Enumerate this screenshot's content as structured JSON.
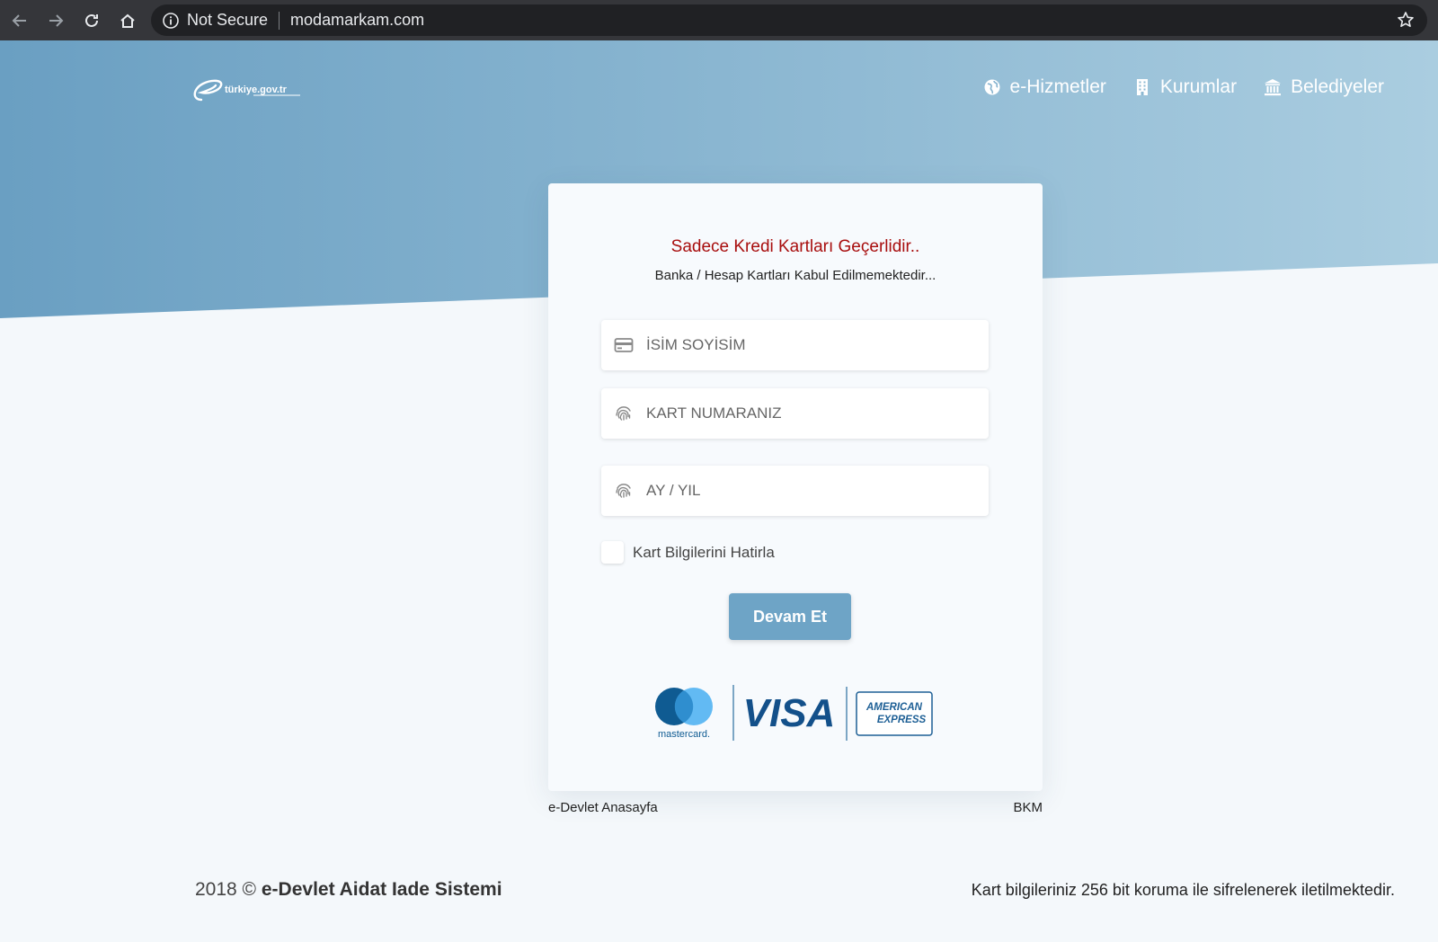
{
  "browser": {
    "security_label": "Not Secure",
    "url": "modamarkam.com"
  },
  "header": {
    "logo_text": "türkiye.gov.tr",
    "nav": [
      {
        "label": "e-Hizmetler",
        "icon": "globe-icon"
      },
      {
        "label": "Kurumlar",
        "icon": "building-icon"
      },
      {
        "label": "Belediyeler",
        "icon": "institution-icon"
      }
    ]
  },
  "form": {
    "title": "Sadece Kredi Kartları Geçerlidir..",
    "subtitle": "Banka / Hesap Kartları Kabul Edilmemektedir...",
    "name_placeholder": "İSİM SOYİSİM",
    "card_placeholder": "KART NUMARANIZ",
    "expiry_placeholder": "AY / YIL",
    "remember_label": "Kart Bilgilerini Hatirla",
    "submit_label": "Devam Et",
    "card_brands": [
      "mastercard.",
      "VISA",
      "AMERICAN",
      "EXPRESS"
    ]
  },
  "links": {
    "left": "e-Devlet Anasayfa",
    "right": "BKM"
  },
  "footer": {
    "year": "2018 ©",
    "site_name": "e-Devlet Aidat Iade Sistemi",
    "security_note": "Kart bilgileriniz 256 bit koruma ile sifrelenerek iletilmektedir."
  },
  "colors": {
    "hero_start": "#6a9fc2",
    "hero_end": "#aacde0",
    "title_red": "#a80e0e",
    "button": "#6ea4c6"
  }
}
